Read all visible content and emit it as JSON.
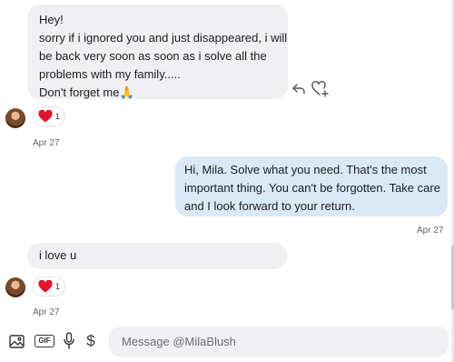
{
  "messages": [
    {
      "lines": [
        "Hey!",
        "sorry if i ignored you and just disappeared, i will",
        "be back very soon as soon as i solve all the",
        "problems with my family.....",
        "Don't forget me🙏"
      ]
    },
    {
      "lines": [
        "Hi, Mila. Solve what you need. That's the most",
        "important thing. You can't be forgotten. Take care",
        "and I look forward to your return."
      ]
    },
    {
      "lines": [
        "i love u"
      ]
    }
  ],
  "reactions": [
    {
      "emoji": "heart-icon",
      "count": "1"
    },
    {
      "emoji": "heart-icon",
      "count": "1"
    }
  ],
  "dates": {
    "first_incoming": "Apr 27",
    "outgoing": "Apr 27",
    "second_incoming": "Apr 27"
  },
  "message_actions": [
    "reply-icon",
    "add-reaction-icon"
  ],
  "composer": {
    "placeholder": "Message @MilaBlush",
    "gif_label": "GIF",
    "tip_symbol": "$",
    "icons": [
      "image-icon",
      "gif-icon",
      "microphone-icon",
      "dollar-icon"
    ]
  },
  "colors": {
    "incoming_bubble": "#f0f0f2",
    "outgoing_bubble": "#d9e9f8",
    "heart": "#e0142c"
  }
}
